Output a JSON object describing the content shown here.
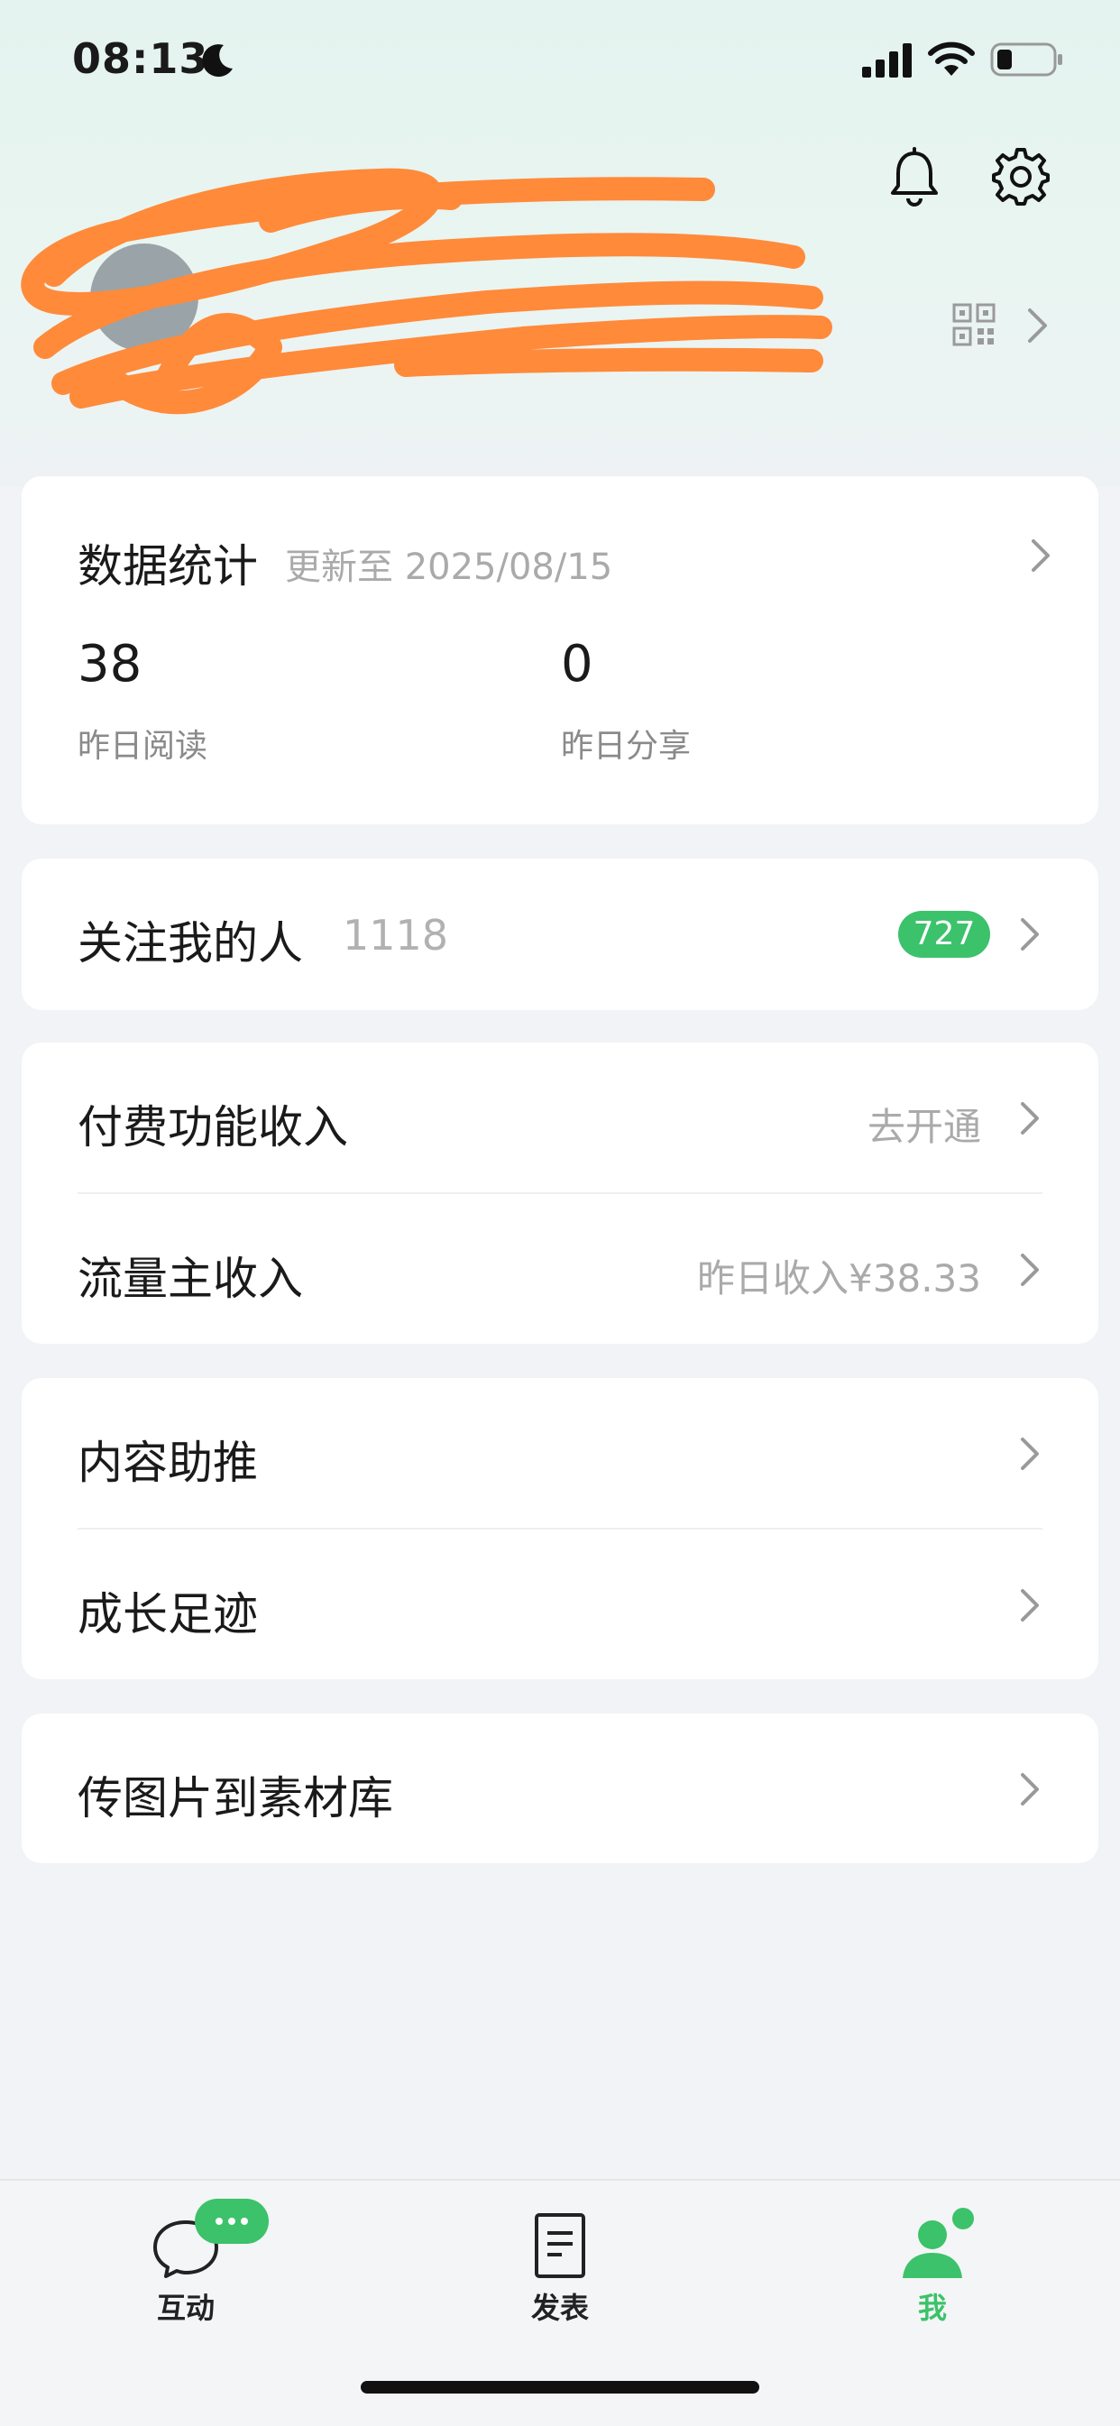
{
  "status_bar": {
    "time": "08:13"
  },
  "header": {
    "icons": [
      "bell-icon",
      "gear-icon"
    ]
  },
  "profile": {
    "name": "",
    "account_line": ""
  },
  "stats": {
    "title": "数据统计",
    "updated": "更新至 2025/08/15",
    "items": [
      {
        "value": "38",
        "label": "昨日阅读"
      },
      {
        "value": "0",
        "label": "昨日分享"
      }
    ]
  },
  "followers": {
    "label": "关注我的人",
    "count": "1118",
    "badge": "727"
  },
  "income": {
    "rows": [
      {
        "label": "付费功能收入",
        "right": "去开通"
      },
      {
        "label": "流量主收入",
        "right": "昨日收入¥38.33"
      }
    ]
  },
  "tools": {
    "rows": [
      {
        "label": "内容助推"
      },
      {
        "label": "成长足迹"
      }
    ]
  },
  "upload": {
    "label": "传图片到素材库"
  },
  "tabbar": {
    "tabs": [
      {
        "label": "互动",
        "icon": "chat-bubble-icon"
      },
      {
        "label": "发表",
        "icon": "document-icon"
      },
      {
        "label": "我",
        "icon": "person-icon",
        "active": true
      }
    ]
  },
  "colors": {
    "accent": "#3cc26a",
    "redaction": "#ff8a3a"
  }
}
